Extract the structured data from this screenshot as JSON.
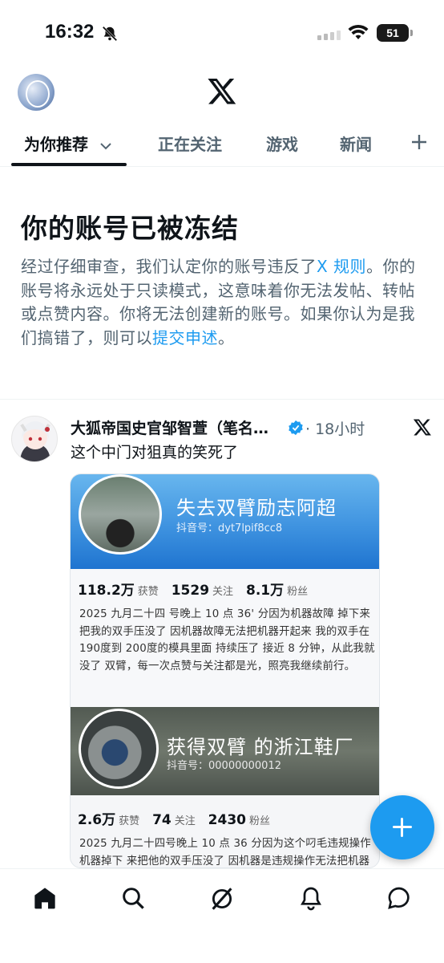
{
  "status_bar": {
    "time": "16:32",
    "battery": "51"
  },
  "tabs": [
    {
      "label": "为你推荐"
    },
    {
      "label": "正在关注"
    },
    {
      "label": "游戏"
    },
    {
      "label": "新闻"
    }
  ],
  "notice": {
    "title": "你的账号已被冻结",
    "body_part1": "经过仔细审查，我们认定你的账号违反了",
    "rules_link": "X 规则",
    "body_part2": "。你的账号将永远处于只读模式，这意味着你无法发帖、转帖或点赞内容。你将无法创建新的账号。如果你认为是我们搞错了，则可以",
    "appeal_link": "提交申述",
    "body_part3": "。"
  },
  "post": {
    "author": "大狐帝国史官邹智萱（笔名…",
    "meta": "· 18小时",
    "text": "这个中门对狙真的笑死了",
    "image": {
      "profile1": {
        "name": "失去双臂励志阿超",
        "douyin_id": "抖音号：dyt7lpif8cc8",
        "likes_value": "118.2万",
        "likes_label": "获赞",
        "follow_value": "1529",
        "follow_label": "关注",
        "fans_value": "8.1万",
        "fans_label": "粉丝",
        "description": "2025 九月二十四 号晚上 10 点 36' 分因为机器故障 掉下来把我的双手压没了 因机器故障无法把机器开起来 我的双手在 190度到 200度的模具里面 持续压了 接近 8 分钟，从此我就没了 双臂，每一次点赞与关注都是光，照亮我继续前行。"
      },
      "profile2": {
        "name": "获得双臂 的浙江鞋厂",
        "douyin_id": "抖音号：00000000012",
        "likes_value": "2.6万",
        "likes_label": "获赞",
        "follow_value": "74",
        "follow_label": "关注",
        "fans_value": "2430",
        "fans_label": "粉丝",
        "description": "2025 九月二十四号晚上 10 点 36 分因为这个叼毛违规操作机器掉下 来把他的双手压没了 因机器是违规操作无法把机器开起来 他的"
      }
    }
  },
  "colors": {
    "accent": "#1d9bf0",
    "text": "#0f1419",
    "secondary": "#536471"
  }
}
